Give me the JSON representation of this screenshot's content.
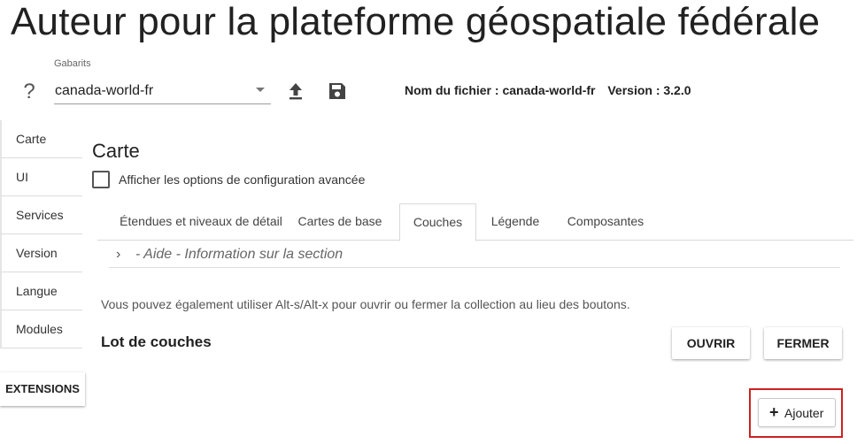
{
  "app": {
    "title": "Auteur pour la plateforme géospatiale fédérale"
  },
  "toolbar": {
    "help_icon": "?",
    "templates_label": "Gabarits",
    "template_value": "canada-world-fr",
    "upload_icon": "upload-icon",
    "save_icon": "save-icon",
    "file_name": "Nom du fichier : canada-world-fr",
    "version": "Version : 3.2.0"
  },
  "sidebar": {
    "items": [
      {
        "label": "Carte"
      },
      {
        "label": "UI"
      },
      {
        "label": "Services"
      },
      {
        "label": "Version"
      },
      {
        "label": "Langue"
      },
      {
        "label": "Modules"
      }
    ],
    "extensions_label": "EXTENSIONS"
  },
  "main": {
    "title": "Carte",
    "advanced_label": "Afficher les options de configuration avancée",
    "advanced_checked": false,
    "tabs": [
      {
        "label": "Étendues et niveaux de détail",
        "active": false
      },
      {
        "label": "Cartes de base",
        "active": false
      },
      {
        "label": "Couches",
        "active": true
      },
      {
        "label": "Légende",
        "active": false
      },
      {
        "label": "Composantes",
        "active": false
      }
    ],
    "help_chevron": "›",
    "help_text": "- Aide - Information sur la section",
    "hint": "Vous pouvez également utiliser Alt-s/Alt-x pour ouvrir ou fermer la collection au lieu des boutons.",
    "group_title": "Lot de couches",
    "open_label": "OUVRIR",
    "close_label": "FERMER",
    "add_plus": "+",
    "add_label": "Ajouter"
  },
  "colors": {
    "highlight": "#cc2222",
    "text": "#212121"
  }
}
